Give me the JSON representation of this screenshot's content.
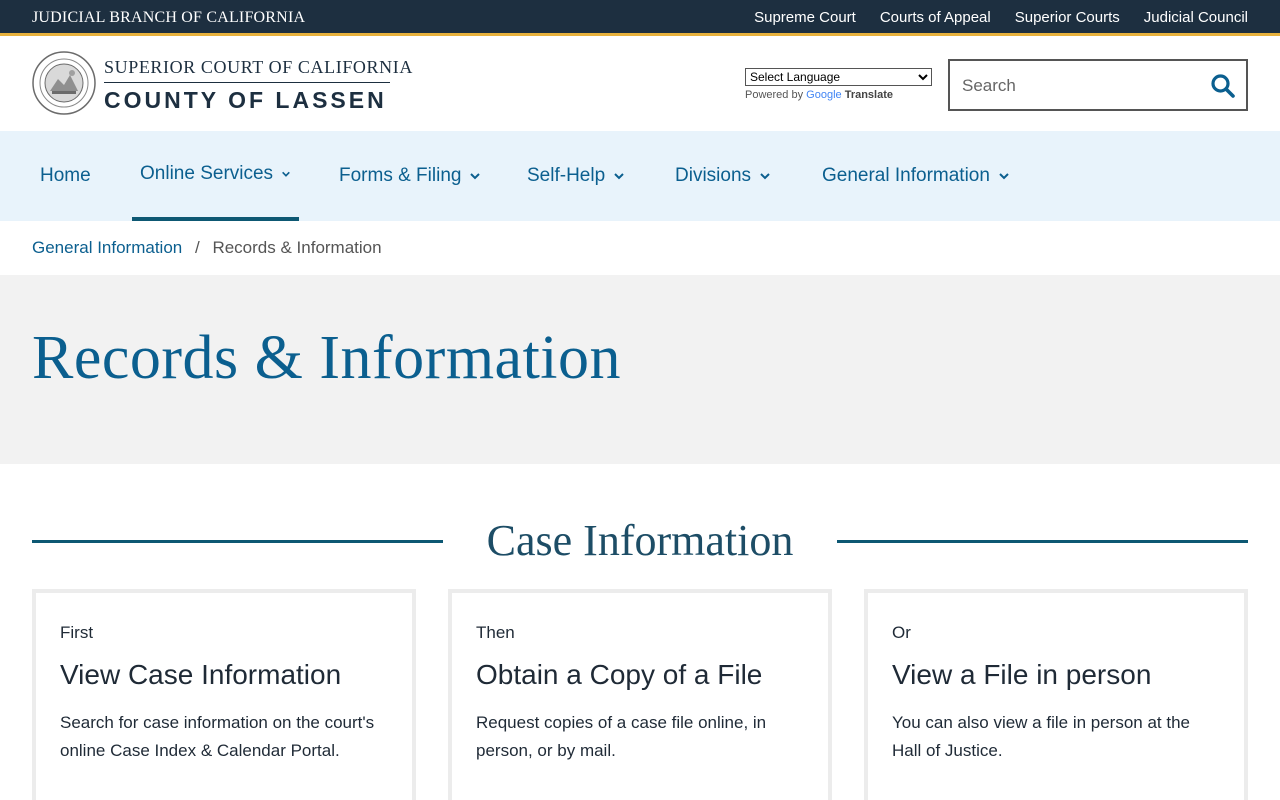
{
  "topbar": {
    "brand": "JUDICIAL BRANCH OF CALIFORNIA",
    "links": [
      "Supreme Court",
      "Courts of Appeal",
      "Superior Courts",
      "Judicial Council"
    ]
  },
  "header": {
    "logo_line1": "SUPERIOR COURT OF CALIFORNIA",
    "logo_line2": "COUNTY OF LASSEN",
    "translate": {
      "selected": "Select Language",
      "powered_by": "Powered by",
      "google": "Google",
      "translate": "Translate"
    },
    "search": {
      "placeholder": "Search"
    }
  },
  "nav": {
    "items": [
      {
        "label": "Home"
      },
      {
        "label": "Online Services"
      },
      {
        "label": "Forms & Filing"
      },
      {
        "label": "Self-Help"
      },
      {
        "label": "Divisions"
      },
      {
        "label": "General Information"
      }
    ]
  },
  "breadcrumb": {
    "parent": "General Information",
    "separator": "/",
    "current": "Records & Information"
  },
  "page": {
    "title": "Records & Information"
  },
  "section": {
    "title": "Case Information",
    "cards": [
      {
        "kicker": "First",
        "title": "View Case Information",
        "body": "Search for case information on the court's online Case Index & Calendar Portal."
      },
      {
        "kicker": "Then",
        "title": "Obtain a Copy of a File",
        "body": "Request copies of a case file online, in person, or by mail."
      },
      {
        "kicker": "Or",
        "title": "View a File in person",
        "body": "You can also view a file in person at the Hall of Justice."
      }
    ]
  },
  "colors": {
    "topbar": "#1d2f40",
    "accent_gold": "#e7b13c",
    "link_blue": "#0b5f8f",
    "nav_bg": "#e8f3fb",
    "hero_bg": "#f2f2f2",
    "section_rule": "#0d5873"
  }
}
